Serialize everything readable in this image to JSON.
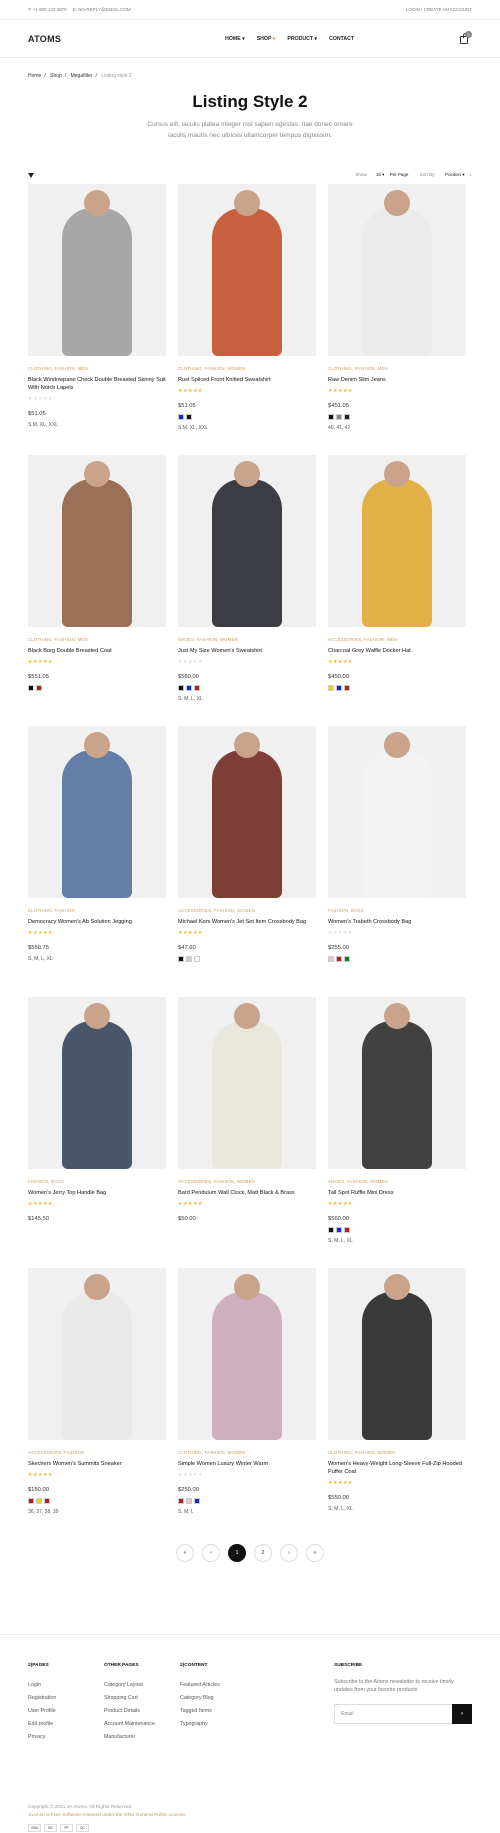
{
  "topbar": {
    "phone": "T: +1 800 123 4870",
    "email": "E: NO-REPLY@EMAIL.COM",
    "account": "LOGIN / CREATE AN ACCOUNT"
  },
  "header": {
    "logo": "ATOMS",
    "nav": [
      "HOME",
      "SHOP",
      "PRODUCT",
      "CONTACT"
    ],
    "cart_count": "0"
  },
  "breadcrumb": [
    "Home",
    "Shop",
    "Megafilter",
    "Listing style 2"
  ],
  "hero": {
    "title": "Listing Style 2",
    "subtitle": "Cursus elit, iaculis platea integer nisl sapien egestas. Itae donec ornare iaculis mauris nec ultrices ullamcorper tempus dignissim."
  },
  "toolbar": {
    "show_label": "Show",
    "show_value": "15",
    "per_page": "Per Page",
    "sort_label": "Sort By:",
    "sort_value": "Position"
  },
  "products": [
    {
      "cats": "CLOTHING, FASHION, MEN",
      "title": "Black Windowpane Check Double Breasted Skinny Suit With Notch Lapels",
      "rating": 0,
      "price": "$51.05",
      "colors": [],
      "sizes": "S.M, XL, XXL"
    },
    {
      "cats": "CLOTHING, FASHION, WOMEN",
      "title": "Rust Spliced Front Knitted Sweatshirt",
      "rating": 5,
      "price": "$51.05",
      "colors": [
        "#1a23d0",
        "#111111"
      ],
      "sizes": "S.M, XL, XXL"
    },
    {
      "cats": "CLOTHING, FASHION, MEN",
      "title": "Raw Denim Slim Jeans",
      "rating": 5,
      "price": "$451.05",
      "colors": [
        "#111111",
        "#888888",
        "#222222"
      ],
      "sizes": "40, 41, 42"
    },
    {
      "cats": "CLOTHING, FASHION, MEN",
      "title": "Black Borg Double Breasted Coat",
      "rating": 5,
      "price": "$551.05",
      "colors": [
        "#111111",
        "#b01e1e"
      ],
      "sizes": ""
    },
    {
      "cats": "SHOES, FASHION, WOMEN",
      "title": "Just My Size Women's Sweatshirt",
      "rating": 0,
      "price": "$560.00",
      "colors": [
        "#111111",
        "#1a23d0",
        "#b01e1e"
      ],
      "sizes": "S, M, L, XL"
    },
    {
      "cats": "ACCESSORIES, FASHION, MEN",
      "title": "Charcoal Grey Waffle Docker Hat",
      "rating": 5,
      "price": "$450.00",
      "colors": [
        "#f3d21a",
        "#1a23d0",
        "#b01e1e"
      ],
      "sizes": ""
    },
    {
      "cats": "CLOTHING, FASHION",
      "title": "Democracy Women's Ab Solution Jegging",
      "rating": 5,
      "price": "$550.75",
      "colors": [],
      "sizes": "S, M, L, XL"
    },
    {
      "cats": "ACCESSORIES, FASHION, WOMEN",
      "title": "Michael Kors Women's Jet Set Item Crossbody Bag",
      "rating": 5,
      "price": "$47.60",
      "colors": [
        "#111111",
        "#cccccc",
        "#ffffff"
      ],
      "sizes": ""
    },
    {
      "cats": "FASHION, BAGS",
      "title": "Women's Trabeth Crossbody Bag",
      "rating": 0,
      "price": "$255.00",
      "colors": [
        "#e8c4c4",
        "#b01e1e",
        "#1a7a1a"
      ],
      "sizes": ""
    },
    {
      "cats": "FASHION, BAGS",
      "title": "Women's Jerry Top Handle Bag",
      "rating": 5,
      "price": "$145.50",
      "colors": [],
      "sizes": ""
    },
    {
      "cats": "ACCESSORIES, FASHION, WOMEN",
      "title": "Bard Pendulum Wall Clock, Matt Black & Brass",
      "rating": 5,
      "price": "$50.00",
      "colors": [],
      "sizes": ""
    },
    {
      "cats": "SHOES, FASHION, WOMEN",
      "title": "Tall Spot Ruffle Mini Dress",
      "rating": 5,
      "price": "$560.00",
      "colors": [
        "#111111",
        "#1a23d0",
        "#b01e1e"
      ],
      "sizes": "S, M, L, XL"
    },
    {
      "cats": "ACCESSORIES, FASHION",
      "title": "Skechers Women's Summits Sneaker",
      "rating": 5,
      "price": "$150.00",
      "colors": [
        "#b01e1e",
        "#f3d21a",
        "#b01e1e"
      ],
      "sizes": "36, 37, 38, 39"
    },
    {
      "cats": "CLOTHING, FASHION, WOMEN",
      "title": "Simple Women Luxury Winter Warm",
      "rating": 0,
      "price": "$250.00",
      "colors": [
        "#b01e1e",
        "#e8c4c4",
        "#1a23d0"
      ],
      "sizes": "S, M, L"
    },
    {
      "cats": "CLOTHING, FASHION, WOMEN",
      "title": "Women's Heavy-Weight Long-Sleeve Full-Zip Hooded Puffer Coat",
      "rating": 5,
      "price": "$550.00",
      "colors": [],
      "sizes": "S, M, L, XL"
    }
  ],
  "pagination": [
    "«",
    "‹",
    "1",
    "2",
    "›",
    "»"
  ],
  "footer": {
    "cols": [
      {
        "title": "2)PAGES",
        "links": [
          "Login",
          "Registration",
          "User Profile",
          "Edit profile",
          "Privacy"
        ]
      },
      {
        "title": "OTHER PAGES",
        "links": [
          "Category Layout",
          "Shopping Cart",
          "Product Details",
          "Account Maintenance",
          "Manufacturer"
        ]
      },
      {
        "title": "2)CONTENT",
        "links": [
          "Featured Articles",
          "Category Blog",
          "Tagged Items",
          "Typography"
        ]
      }
    ],
    "subscribe": {
      "title": "SUBSCRIBE",
      "text": "Subscribe to the Atoms newsletter to receive timely updates from your favorite products.",
      "placeholder": "Email",
      "button": "›"
    },
    "copyright": "Copyright © 2021 JA Atoms. All Rights Reserved.",
    "license": "Joomla! is Free Software released under the GNU General Public License.",
    "payments": [
      "VISA",
      "MC",
      "PP",
      "DC"
    ]
  }
}
